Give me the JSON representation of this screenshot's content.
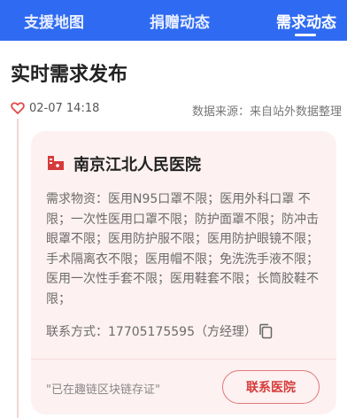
{
  "tabs": [
    {
      "label": "支援地图"
    },
    {
      "label": "捐赠动态"
    },
    {
      "label": "需求动态",
      "active": true
    }
  ],
  "page_title": "实时需求发布",
  "post": {
    "date": "02-07 14:18",
    "source": "数据来源：来自站外数据整理",
    "hospital": "南京江北人民医院",
    "needs": "需求物资：医用N95口罩不限；医用外科口罩 不限；一次性医用口罩不限；防护面罩不限；防冲击眼罩不限；医用防护服不限；医用防护眼镜不限；手术隔离衣不限；医用帽不限；免洗洗手液不限；医用一次性手套不限；医用鞋套不限；长筒胶鞋不限；",
    "contact": "联系方式：17705175595（方经理）",
    "chain_note": "\"已在趣链区块链存证\"",
    "contact_button": "联系医院"
  },
  "colors": {
    "topbar": "#2f6bf2",
    "card_bg": "#fdf1f1",
    "accent_red": "#d63b3b"
  },
  "icons": [
    "heart-icon",
    "hospital-icon",
    "copy-icon"
  ]
}
